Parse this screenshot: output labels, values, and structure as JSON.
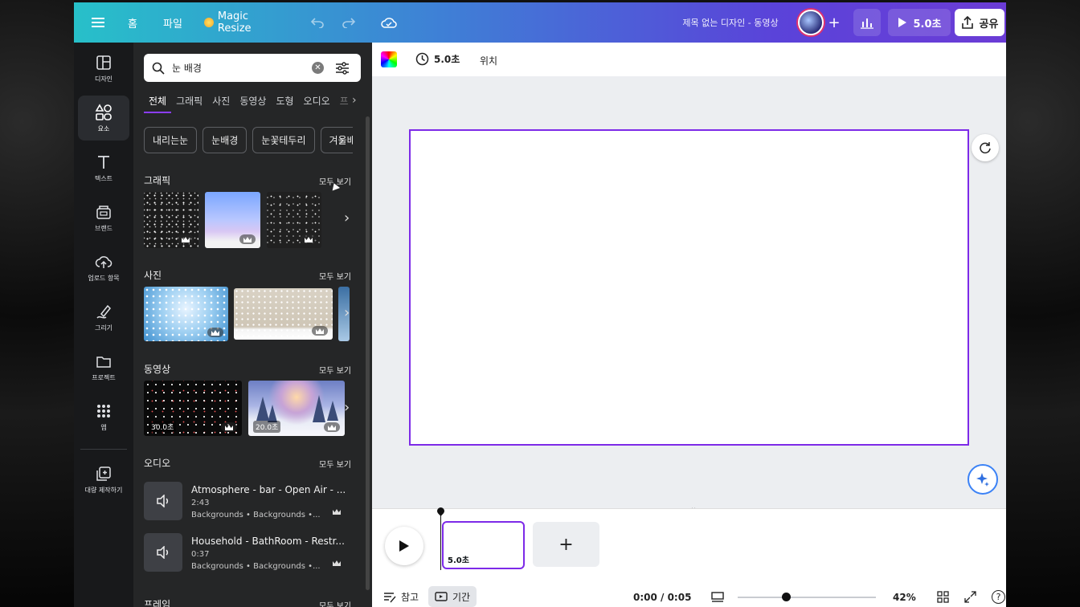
{
  "colors": {
    "accent": "#8b3dff",
    "topbar_start": "#27c0c9",
    "topbar_end": "#6b3cd6",
    "panel_bg": "#252627",
    "sidebar_bg": "#18191b"
  },
  "topbar": {
    "menu_icon": "hamburger-icon",
    "home": "홈",
    "file": "파일",
    "magic_resize": "Magic Resize",
    "doc_title": "제목 없는 디자인 - 동영상",
    "present_label": "5.0초",
    "share_label": "공유"
  },
  "sidebar": {
    "items": [
      {
        "label": "디자인",
        "icon": "design-icon"
      },
      {
        "label": "요소",
        "icon": "elements-icon"
      },
      {
        "label": "텍스트",
        "icon": "text-icon"
      },
      {
        "label": "브랜드",
        "icon": "brand-icon"
      },
      {
        "label": "업로드 항목",
        "icon": "upload-icon"
      },
      {
        "label": "그리기",
        "icon": "draw-icon"
      },
      {
        "label": "프로젝트",
        "icon": "folder-icon"
      },
      {
        "label": "앱",
        "icon": "apps-icon"
      },
      {
        "label": "대량 제작하기",
        "icon": "bulk-create-icon"
      }
    ]
  },
  "panel": {
    "search": {
      "value": "눈 배경"
    },
    "tabs": [
      "전체",
      "그래픽",
      "사진",
      "동영상",
      "도형",
      "오디오"
    ],
    "chips": [
      "내리는눈",
      "눈배경",
      "눈꽃테두리",
      "겨울배"
    ],
    "see_all": "모두 보기",
    "sections": {
      "graphics": "그래픽",
      "photos": "사진",
      "videos": "동영상",
      "audio": "오디오",
      "frames": "프레임"
    },
    "videos": [
      {
        "duration": "30.0초"
      },
      {
        "duration": "20.0초"
      }
    ],
    "audio": [
      {
        "title": "Atmosphere - bar - Open Air - ...",
        "length": "2:43",
        "tags": "Backgrounds • Backgrounds •..."
      },
      {
        "title": "Household - BathRoom - Restr...",
        "length": "0:37",
        "tags": "Backgrounds • Backgrounds •..."
      }
    ]
  },
  "editor": {
    "duration": "5.0초",
    "position": "위치",
    "clip_duration": "5.0초",
    "notes": "참고",
    "timing": "기간",
    "time": "0:00 / 0:05",
    "zoom_pct": "42%",
    "zoom_slider_fraction": 0.35
  }
}
